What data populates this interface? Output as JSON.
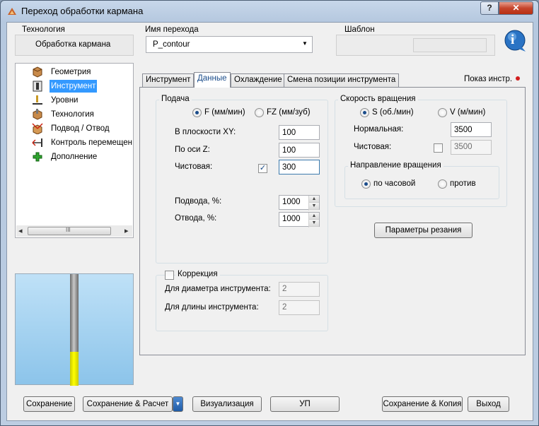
{
  "window": {
    "title": "Переход обработки кармана",
    "help_glyph": "?",
    "close_glyph": "✕"
  },
  "header": {
    "technology_label": "Технология",
    "technology_value": "Обработка кармана",
    "name_label": "Имя перехода",
    "name_value": "P_contour",
    "template_label": "Шаблон",
    "info_glyph": "i"
  },
  "tree": {
    "items": [
      {
        "label": "Геометрия",
        "icon": "geometry-icon"
      },
      {
        "label": "Инструмент",
        "icon": "tool-icon",
        "selected": true
      },
      {
        "label": "Уровни",
        "icon": "levels-icon"
      },
      {
        "label": "Технология",
        "icon": "technology-icon"
      },
      {
        "label": "Подвод / Отвод",
        "icon": "approach-retract-icon"
      },
      {
        "label": "Контроль перемещен",
        "icon": "movement-control-icon"
      },
      {
        "label": "Дополнение",
        "icon": "addition-icon"
      }
    ],
    "scroll_left": "◂",
    "scroll_right": "▸",
    "scroll_thumb": "III"
  },
  "tabs": [
    {
      "label": "Инструмент"
    },
    {
      "label": "Данные",
      "active": true
    },
    {
      "label": "Охлаждение"
    },
    {
      "label": "Смена позиции инструмента"
    }
  ],
  "show_tool_label": "Показ инстр.",
  "feed": {
    "title": "Подача",
    "radio_f": "F (мм/мин)",
    "radio_fz": "FZ (мм/зуб)",
    "xy_label": "В плоскости XY:",
    "xy_value": "100",
    "z_label": "По оси Z:",
    "z_value": "100",
    "finish_label": "Чистовая:",
    "finish_value": "300",
    "approach_label": "Подвода, %:",
    "approach_value": "1000",
    "retract_label": "Отвода, %:",
    "retract_value": "1000"
  },
  "speed": {
    "title": "Скорость вращения",
    "radio_s": "S (об./мин)",
    "radio_v": "V (м/мин)",
    "normal_label": "Нормальная:",
    "normal_value": "3500",
    "finish_label": "Чистовая:",
    "finish_value": "3500",
    "direction_title": "Направление вращения",
    "cw": "по часовой",
    "ccw": "против"
  },
  "cutting_params_button": "Параметры резания",
  "correction": {
    "title": "Коррекция",
    "diameter_label": "Для диаметра инструмента:",
    "diameter_value": "2",
    "length_label": "Для длины инструмента:",
    "length_value": "2"
  },
  "footer": {
    "save": "Сохранение",
    "save_calc": "Сохранение & Расчет",
    "visualize": "Визуализация",
    "up": "УП",
    "save_copy": "Сохранение & Копия",
    "exit": "Выход"
  },
  "colors": {
    "accent": "#1a4c8a",
    "selection": "#3399ff",
    "tool_yellow": "#ffff00",
    "indicator_red": "#d21e1e"
  }
}
